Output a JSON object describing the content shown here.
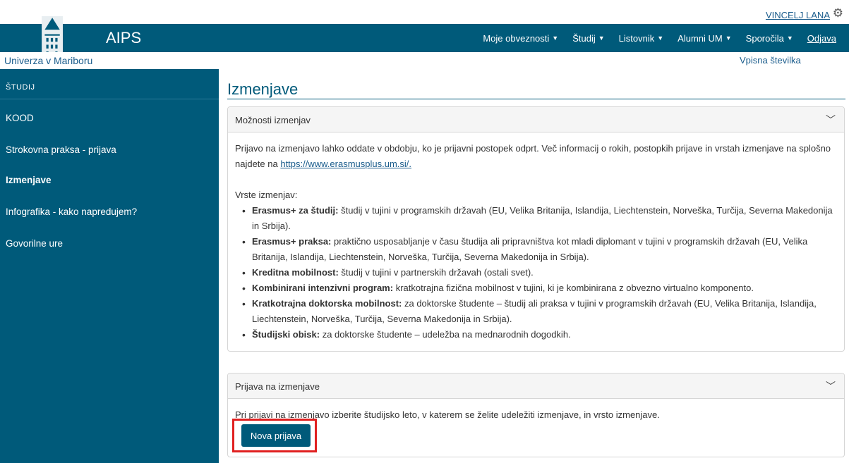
{
  "header": {
    "user_name": "VINCELJ LANA",
    "brand": "AIPS",
    "university": "Univerza v Mariboru",
    "student_number_label": "Vpisna številka",
    "nav": [
      {
        "label": "Moje obveznosti"
      },
      {
        "label": "Študij"
      },
      {
        "label": "Listovnik"
      },
      {
        "label": "Alumni UM"
      },
      {
        "label": "Sporočila"
      },
      {
        "label": "Odjava"
      }
    ]
  },
  "sidebar": {
    "title": "ŠTUDIJ",
    "items": [
      {
        "label": "KOOD"
      },
      {
        "label": "Strokovna praksa - prijava"
      },
      {
        "label": "Izmenjave",
        "active": true
      },
      {
        "label": "Infografika - kako napredujem?"
      },
      {
        "label": "Govorilne ure"
      }
    ]
  },
  "main": {
    "title": "Izmenjave",
    "card1": {
      "title": "Možnosti izmenjav",
      "intro_text": "Prijavo na izmenjavo lahko oddate v obdobju, ko je prijavni postopek odprt. Več informacij o rokih, postopkih prijave in vrstah izmenjave na splošno najdete na ",
      "intro_link": "https://www.erasmusplus.um.si/.",
      "types_heading": "Vrste izmenjav:",
      "types": [
        {
          "name": "Erasmus+ za študij:",
          "desc": " študij v tujini v programskih državah (EU, Velika Britanija, Islandija, Liechtenstein, Norveška, Turčija, Severna Makedonija in Srbija)."
        },
        {
          "name": "Erasmus+ praksa:",
          "desc": " praktično usposabljanje v času študija ali pripravništva kot mladi diplomant v tujini v programskih državah (EU, Velika Britanija, Islandija, Liechtenstein, Norveška, Turčija, Severna Makedonija in Srbija)."
        },
        {
          "name": "Kreditna mobilnost:",
          "desc": " študij v tujini v partnerskih državah (ostali svet)."
        },
        {
          "name": "Kombinirani intenzivni program:",
          "desc": " kratkotrajna fizična mobilnost v tujini, ki je kombinirana z obvezno virtualno komponento."
        },
        {
          "name": "Kratkotrajna doktorska mobilnost:",
          "desc": " za doktorske študente – študij ali praksa v tujini v programskih državah (EU, Velika Britanija, Islandija, Liechtenstein, Norveška, Turčija, Severna Makedonija in Srbija)."
        },
        {
          "name": "Študijski obisk:",
          "desc": " za doktorske študente – udeležba na mednarodnih dogodkih."
        }
      ]
    },
    "card2": {
      "title": "Prijava na izmenjave",
      "text": "Pri prijavi na izmenjavo izberite študijsko leto, v katerem se želite udeležiti izmenjave, in vrsto izmenjave.",
      "button_label": "Nova prijava"
    }
  }
}
